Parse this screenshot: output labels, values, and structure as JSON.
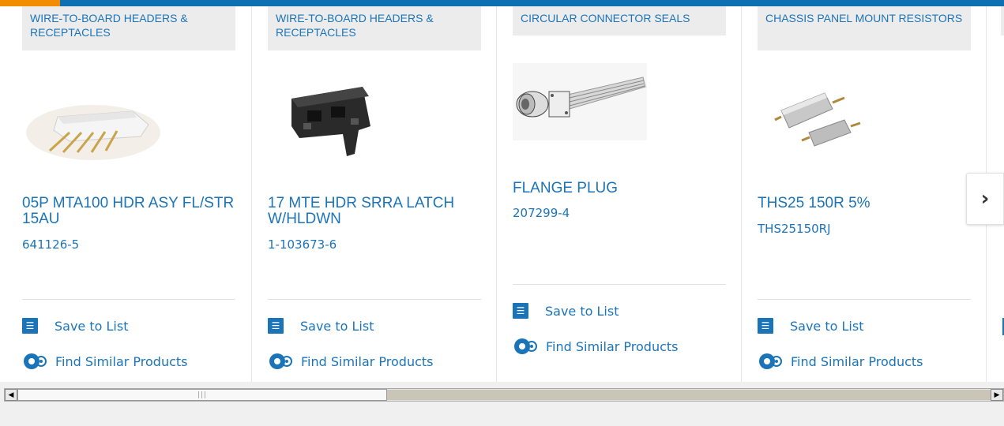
{
  "progress": {
    "fraction": 0.06,
    "accent": "#f28c00",
    "base": "#0f6fb3"
  },
  "colors": {
    "link": "#1c74b8",
    "category_bg": "#ececec"
  },
  "cards": [
    {
      "category": "WIRE-TO-BOARD HEADERS & RECEPTACLES",
      "name": "05P MTA100 HDR ASY FL/STR 15AU",
      "part_number": "641126-5",
      "image": "header-connector-image",
      "save_label": "Save to List",
      "similar_label": "Find Similar Products"
    },
    {
      "category": "WIRE-TO-BOARD HEADERS & RECEPTACLES",
      "name": "17 MTE HDR SRRA LATCH W/HLDWN",
      "part_number": "1-103673-6",
      "image": "black-header-image",
      "save_label": "Save to List",
      "similar_label": "Find Similar Products"
    },
    {
      "category": "CIRCULAR CONNECTOR SEALS",
      "name": "FLANGE PLUG",
      "part_number": "207299-4",
      "image": "flange-plug-image",
      "save_label": "Save to List",
      "similar_label": "Find Similar Products"
    },
    {
      "category": "CHASSIS PANEL MOUNT RESISTORS",
      "name": "THS25 150R 5%",
      "part_number": "THS25150RJ",
      "image": "resistor-image",
      "save_label": "Save to List",
      "similar_label": "Find Similar Products"
    }
  ],
  "next_icon": "chevron-right-icon",
  "scrollbar": {
    "position_fraction": 0.0,
    "thumb_fraction": 0.38
  }
}
